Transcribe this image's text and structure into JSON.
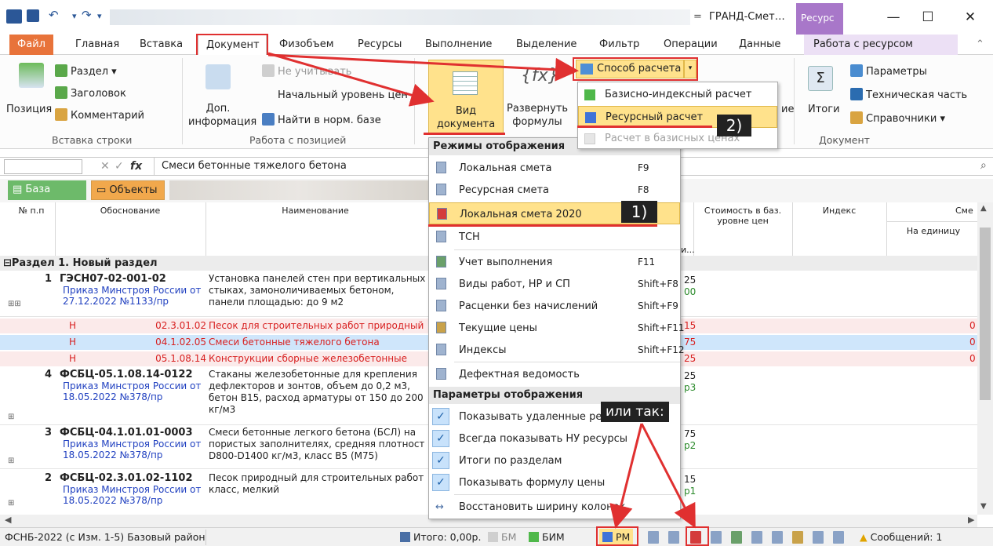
{
  "window": {
    "title": "ГРАНД-Смет…",
    "context_tab_title": "Ресурс",
    "minimize": "—",
    "maximize": "☐",
    "close": "✕"
  },
  "quick_access": {
    "undo": "↶",
    "redo": "↷",
    "customize": "="
  },
  "tabs": {
    "file": "Файл",
    "home": "Главная",
    "insert": "Вставка",
    "document": "Документ",
    "physical_volume": "Физобъем",
    "resources": "Ресурсы",
    "execution": "Выполнение",
    "selection": "Выделение",
    "filter": "Фильтр",
    "operations": "Операции",
    "data": "Данные",
    "work_with_resource": "Работа с ресурсом"
  },
  "ribbon": {
    "position_label": "Позиция",
    "section_label": "Раздел",
    "heading_label": "Заголовок",
    "comment_label": "Комментарий",
    "group_insert_row": "Вставка строки",
    "extra_info_label": "Доп. информация",
    "no_account_label": "Не учитывать",
    "base_price_level_label": "Начальный уровень цен",
    "find_in_norm_base_label": "Найти в норм. базе",
    "group_work_with_position": "Работа с позицией",
    "doc_view_label": "Вид документа",
    "expand_formulas_label": "Развернуть формулы",
    "calc_method_label": "Способ расчета",
    "hidden_label_fragment": "ие",
    "totals_label": "Итоги",
    "parameters_label": "Параметры",
    "technical_part_label": "Техническая часть",
    "references_label": "Справочники",
    "group_document": "Документ"
  },
  "formula_bar": {
    "cancel": "✕",
    "confirm": "✓",
    "fx": "fx",
    "value": "Смеси бетонные тяжелого бетона"
  },
  "toolbar2": {
    "base_button": "База",
    "objects_button": "Объекты"
  },
  "grid_header": {
    "num": "№ п.п",
    "justification": "Обоснование",
    "name": "Наименование",
    "partial": "и...",
    "cost_base": "Стоимость в баз. уровне цен",
    "index": "Индекс",
    "estimate_prefix": "Сме",
    "per_unit": "На единицу"
  },
  "section_row": "Раздел 1. Новый раздел",
  "rows": [
    {
      "num": "1",
      "code": "ГЭСН07-02-001-02",
      "ref": "Приказ Минстроя России от 27.12.2022 №1133/пр",
      "name": "Установка панелей стен при вертикальных стыках, замоноличиваемых бетоном, панели площадью: до 9 м2",
      "tail_top": "25",
      "tail_bottom": "00"
    },
    {
      "num": "4",
      "code": "ФСБЦ-05.1.08.14-0122",
      "ref": "Приказ Минстроя России от 18.05.2022 №378/пр",
      "name": "Стаканы железобетонные для крепления дефлекторов и зонтов, объем до 0,2 м3, бетон B15, расход арматуры от 150 до 200 кг/м3",
      "tail_top": "25",
      "tail_bottom": "p3"
    },
    {
      "num": "3",
      "code": "ФСБЦ-04.1.01.01-0003",
      "ref": "Приказ Минстроя России от 18.05.2022 №378/пр",
      "name": "Смеси бетонные легкого бетона (БСЛ) на пористых заполнителях, средняя плотност D800-D1400 кг/м3, класс B5 (M75)",
      "tail_top": "75",
      "tail_bottom": "p2"
    },
    {
      "num": "2",
      "code": "ФСБЦ-02.3.01.02-1102",
      "ref": "Приказ Минстроя России от 18.05.2022 №378/пр",
      "name": "Песок природный для строительных работ класс, мелкий",
      "tail_top": "15",
      "tail_bottom": "p1"
    }
  ],
  "resources": [
    {
      "letter": "Н",
      "code": "02.3.01.02",
      "name": "Песок для строительных работ природный",
      "tail": "15",
      "zero": "0"
    },
    {
      "letter": "Н",
      "code": "04.1.02.05",
      "name": "Смеси бетонные тяжелого бетона",
      "tail": "75",
      "zero": "0"
    },
    {
      "letter": "Н",
      "code": "05.1.08.14",
      "name": "Конструкции сборные железобетонные",
      "tail": "25",
      "zero": "0"
    }
  ],
  "dropdown_view": {
    "header_modes": "Режимы отображения",
    "items": [
      {
        "label": "Локальная смета",
        "key": "F9"
      },
      {
        "label": "Ресурсная смета",
        "key": "F8"
      },
      {
        "label": "Локальная смета 2020",
        "key": ""
      },
      {
        "label": "ТСН",
        "key": ""
      },
      {
        "label": "Учет выполнения",
        "key": "F11"
      },
      {
        "label": "Виды работ, НР и СП",
        "key": "Shift+F8"
      },
      {
        "label": "Расценки без начислений",
        "key": "Shift+F9"
      },
      {
        "label": "Текущие цены",
        "key": "Shift+F11"
      },
      {
        "label": "Индексы",
        "key": "Shift+F12"
      },
      {
        "label": "Дефектная ведомость",
        "key": ""
      }
    ],
    "header_params": "Параметры отображения",
    "params": [
      {
        "label": "Показывать удаленные ресурсы"
      },
      {
        "label": "Всегда показывать НУ ресурсы"
      },
      {
        "label": "Итоги по разделам"
      },
      {
        "label": "Показывать формулу цены"
      }
    ],
    "restore_width": "Восстановить ширину колонок"
  },
  "dropdown_calc": {
    "items": [
      {
        "label": "Базисно-индексный расчет",
        "color": "#4fb84a"
      },
      {
        "label": "Ресурсный расчет",
        "color": "#3f73d8"
      },
      {
        "label": "Расчет в базисных ценах",
        "color": "#dddddd"
      }
    ]
  },
  "callouts": {
    "one": "1)",
    "two": "2)",
    "or_like_this": "или так:"
  },
  "status": {
    "norm_base": "ФСНБ-2022 (с Изм. 1-5)  Базовый район",
    "total": "Итого: 0,00р.",
    "bm": "БМ",
    "bim": "БИМ",
    "rm": "РМ",
    "messages": "Сообщений: 1"
  },
  "colors": {
    "file_tab": "#e8733a",
    "context_tab": "#a877c9",
    "highlight_yellow": "#ffe28c",
    "selected_row": "#cfe6fb",
    "resource_red": "#d82020",
    "annotation_red": "#e03030"
  }
}
